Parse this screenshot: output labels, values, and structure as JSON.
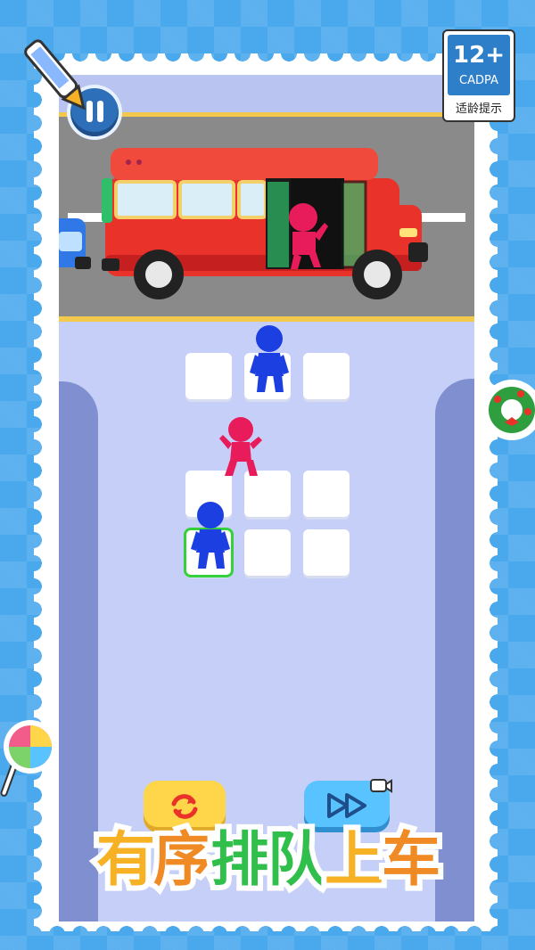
{
  "game": {
    "rating_badge": {
      "age": "12+",
      "org": "CADPA",
      "label": "适龄提示"
    },
    "title_chars": [
      "有",
      "序",
      "排",
      "队",
      "上",
      "车"
    ],
    "title_colors": [
      "#f6b224",
      "#f08a24",
      "#2fbf4a",
      "#2fbf4a",
      "#f6b224",
      "#f08a24"
    ],
    "buttons": {
      "restart": "restart-icon",
      "skip": "fast-forward-icon",
      "pause": "pause-icon"
    }
  },
  "colors": {
    "background": "#4aa8ec",
    "board": "#c6cff7",
    "road": "#8a8a8a",
    "bus": "#e8322a",
    "blue_figure": "#1b3fe0",
    "pink_figure": "#e81c5a",
    "selected_tile": "#35d13b"
  }
}
